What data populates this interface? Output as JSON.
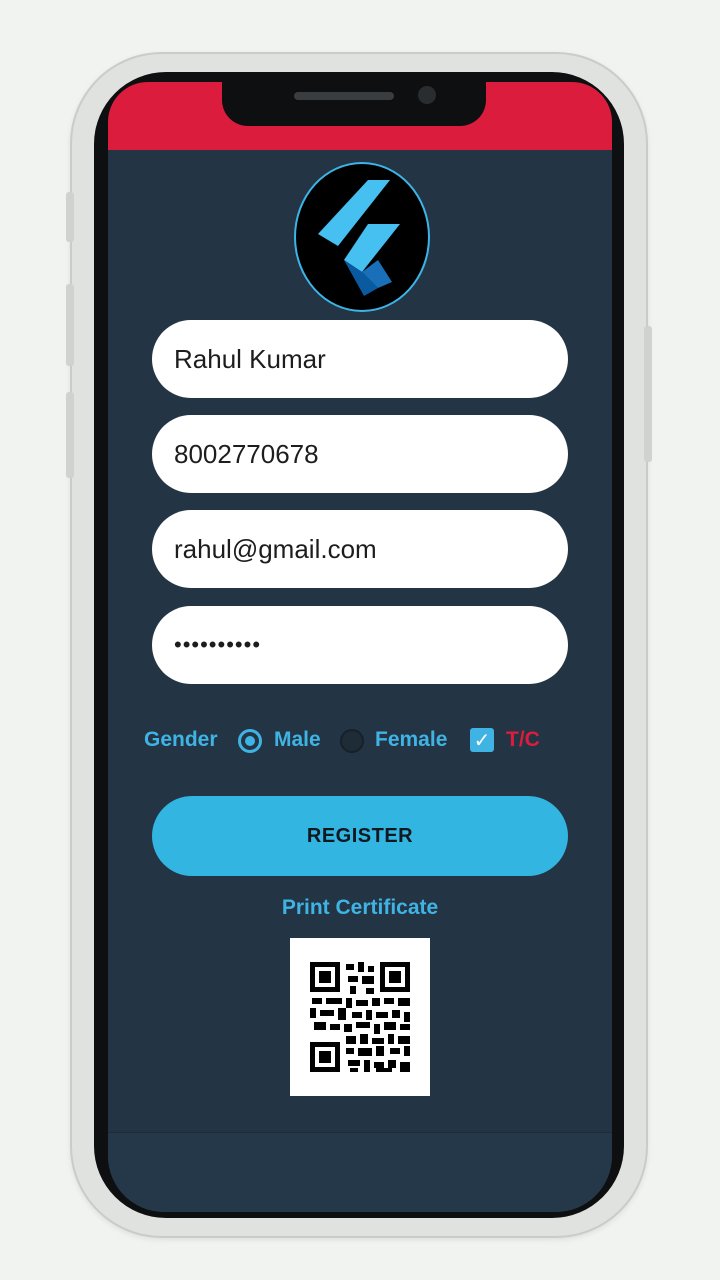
{
  "form": {
    "name_value": "Rahul Kumar",
    "phone_value": "8002770678",
    "email_value": "rahul@gmail.com",
    "password_value": "••••••••••"
  },
  "options": {
    "gender_label": "Gender",
    "male_label": "Male",
    "female_label": "Female",
    "selected_gender": "Male",
    "tc_label": "T/C",
    "tc_checked": true,
    "check_glyph": "✓"
  },
  "actions": {
    "register_label": "REGISTER",
    "print_label": "Print Certificate"
  },
  "colors": {
    "status_bar": "#dc1c3c",
    "screen_bg": "#233445",
    "accent": "#3fb4e4",
    "tc_text": "#dc1c3c"
  }
}
